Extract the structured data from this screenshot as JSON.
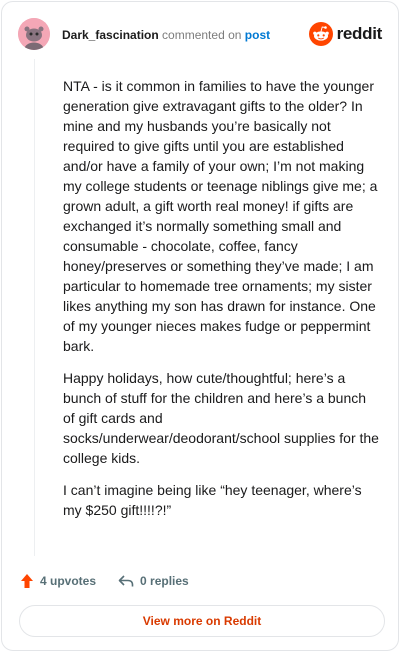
{
  "header": {
    "username": "Dark_fascination",
    "commented_text": "commented on",
    "post_link": "post",
    "brand": "reddit",
    "brand_color": "#ff4500"
  },
  "comment": {
    "paragraphs": [
      "NTA - is it common in families to have the younger generation give extravagant gifts to the older? In mine and my husbands you’re basically not required to give gifts until you are established and/or have a family of your own; I’m not making my college students or teenage niblings give me; a grown adult, a gift worth real money! if gifts are exchanged it’s normally something small and consumable - chocolate, coffee, fancy honey/preserves or something they’ve made; I am particular to homemade tree ornaments; my sister likes anything my son has drawn for instance. One of my younger nieces makes fudge or peppermint bark.",
      "Happy holidays, how cute/thoughtful; here’s a bunch of stuff for the children and here’s a bunch of gift cards and socks/underwear/deodorant/school supplies for the college kids.",
      "I can’t imagine being like “hey teenager, where’s my $250 gift!!!!?!”"
    ]
  },
  "actions": {
    "upvotes": "4 upvotes",
    "replies": "0 replies",
    "upvote_icon": "arrow-up-icon",
    "reply_icon": "reply-icon",
    "upvote_color": "#ff4500"
  },
  "footer": {
    "view_more": "View more on Reddit"
  }
}
